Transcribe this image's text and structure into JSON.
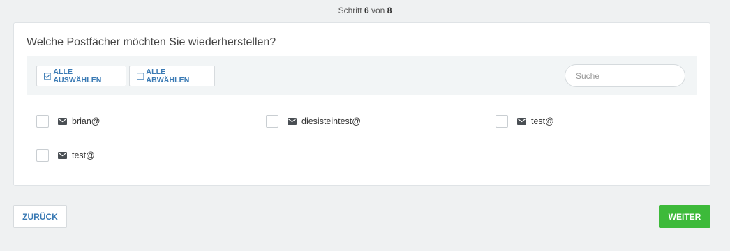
{
  "step": {
    "prefix": "Schritt",
    "current": "6",
    "separator": "von",
    "total": "8"
  },
  "question": "Welche Postfächer möchten Sie wiederherstellen?",
  "toolbar": {
    "select_all_label": "ALLE AUSWÄHLEN",
    "deselect_all_label": "ALLE ABWÄHLEN",
    "search_placeholder": "Suche",
    "search_value": ""
  },
  "mailboxes": [
    {
      "name": "brian@",
      "checked": false
    },
    {
      "name": "diesisteintest@",
      "checked": false
    },
    {
      "name": "test@",
      "checked": false
    },
    {
      "name": "test@",
      "checked": false
    }
  ],
  "nav": {
    "back_label": "ZURÜCK",
    "next_label": "WEITER"
  },
  "colors": {
    "accent": "#3a7ab4",
    "primary_button": "#3dba3a",
    "background": "#eff1f2"
  },
  "icons": {
    "select_all": "checked-square-icon",
    "deselect_all": "empty-square-icon",
    "mailbox": "envelope-icon"
  }
}
